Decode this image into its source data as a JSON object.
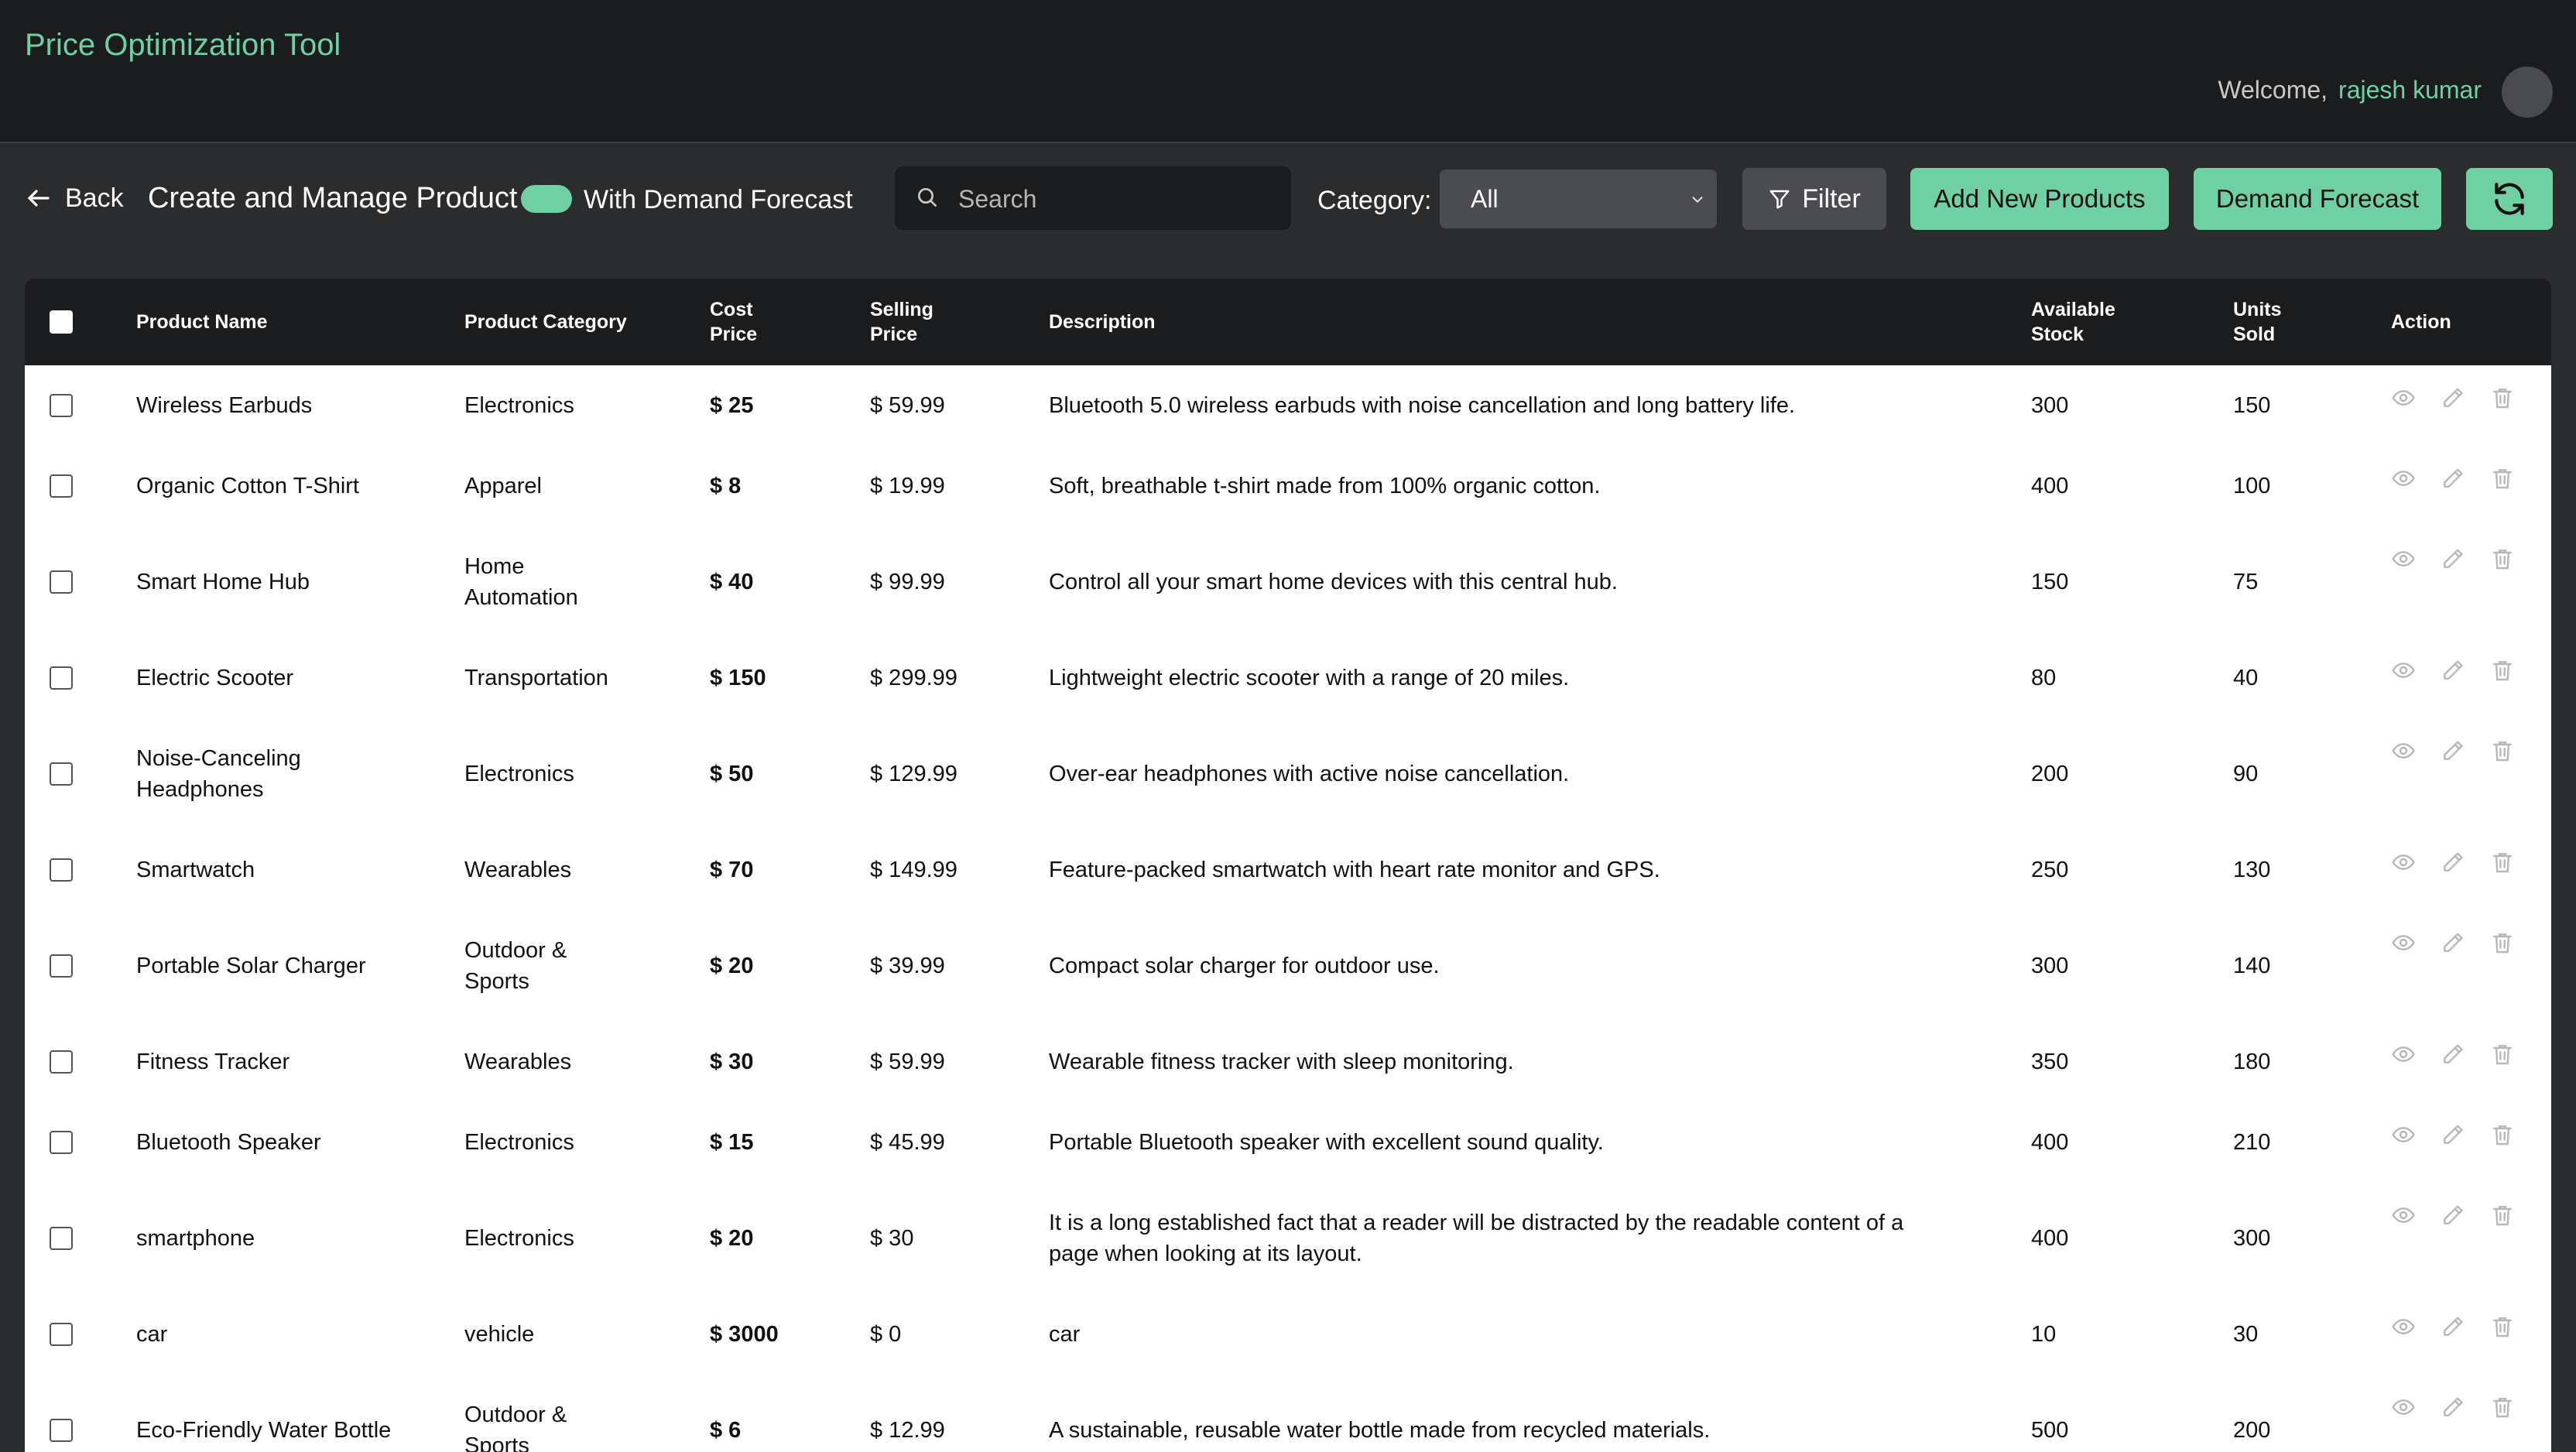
{
  "header": {
    "app_title": "Price Optimization Tool",
    "welcome_label": "Welcome,",
    "user_name": "rajesh kumar"
  },
  "toolbar": {
    "back_label": "Back",
    "page_title": "Create and Manage Product",
    "toggle_label": "With Demand Forecast",
    "toggle_on": true,
    "search_placeholder": "Search",
    "search_value": "",
    "category_label": "Category:",
    "category_selected": "All",
    "filter_label": "Filter",
    "add_label": "Add New Products",
    "demand_label": "Demand Forecast"
  },
  "colors": {
    "accent": "#6fd1a3",
    "header_bg": "#1b1c1e",
    "page_bg": "#2b2c2e"
  },
  "table": {
    "columns": [
      "Product Name",
      "Product Category",
      "Cost Price",
      "Selling Price",
      "Description",
      "Available Stock",
      "Units Sold",
      "Action"
    ],
    "rows": [
      {
        "name": "Wireless Earbuds",
        "category": "Electronics",
        "cost": "$ 25",
        "selling": "$ 59.99",
        "description": "Bluetooth 5.0 wireless earbuds with noise cancellation and long battery life.",
        "stock": "300",
        "sold": "150"
      },
      {
        "name": "Organic Cotton T-Shirt",
        "category": "Apparel",
        "cost": "$ 8",
        "selling": "$ 19.99",
        "description": "Soft, breathable t-shirt made from 100% organic cotton.",
        "stock": "400",
        "sold": "100"
      },
      {
        "name": "Smart Home Hub",
        "category": "Home Automation",
        "cost": "$ 40",
        "selling": "$ 99.99",
        "description": "Control all your smart home devices with this central hub.",
        "stock": "150",
        "sold": "75"
      },
      {
        "name": "Electric Scooter",
        "category": "Transportation",
        "cost": "$ 150",
        "selling": "$ 299.99",
        "description": "Lightweight electric scooter with a range of 20 miles.",
        "stock": "80",
        "sold": "40"
      },
      {
        "name": "Noise-Canceling Headphones",
        "category": "Electronics",
        "cost": "$ 50",
        "selling": "$ 129.99",
        "description": "Over-ear headphones with active noise cancellation.",
        "stock": "200",
        "sold": "90"
      },
      {
        "name": "Smartwatch",
        "category": "Wearables",
        "cost": "$ 70",
        "selling": "$ 149.99",
        "description": "Feature-packed smartwatch with heart rate monitor and GPS.",
        "stock": "250",
        "sold": "130"
      },
      {
        "name": "Portable Solar Charger",
        "category": "Outdoor & Sports",
        "cost": "$ 20",
        "selling": "$ 39.99",
        "description": "Compact solar charger for outdoor use.",
        "stock": "300",
        "sold": "140"
      },
      {
        "name": "Fitness Tracker",
        "category": "Wearables",
        "cost": "$ 30",
        "selling": "$ 59.99",
        "description": "Wearable fitness tracker with sleep monitoring.",
        "stock": "350",
        "sold": "180"
      },
      {
        "name": "Bluetooth Speaker",
        "category": "Electronics",
        "cost": "$ 15",
        "selling": "$ 45.99",
        "description": "Portable Bluetooth speaker with excellent sound quality.",
        "stock": "400",
        "sold": "210"
      },
      {
        "name": "smartphone",
        "category": "Electronics",
        "cost": "$ 20",
        "selling": "$ 30",
        "description": "It is a long established fact that a reader will be distracted by the readable content of a page when looking at its layout.",
        "stock": "400",
        "sold": "300"
      },
      {
        "name": "car",
        "category": "vehicle",
        "cost": "$ 3000",
        "selling": "$ 0",
        "description": "car",
        "stock": "10",
        "sold": "30"
      },
      {
        "name": "Eco-Friendly Water Bottle",
        "category": "Outdoor & Sports",
        "cost": "$ 6",
        "selling": "$ 12.99",
        "description": "A sustainable, reusable water bottle made from recycled materials.",
        "stock": "500",
        "sold": "200"
      }
    ]
  },
  "icons": {
    "back": "arrow-left-icon",
    "search": "search-icon",
    "dropdown": "chevron-down-icon",
    "filter": "filter-icon",
    "refresh": "refresh-icon",
    "view": "eye-icon",
    "edit": "pencil-icon",
    "delete": "trash-icon"
  }
}
